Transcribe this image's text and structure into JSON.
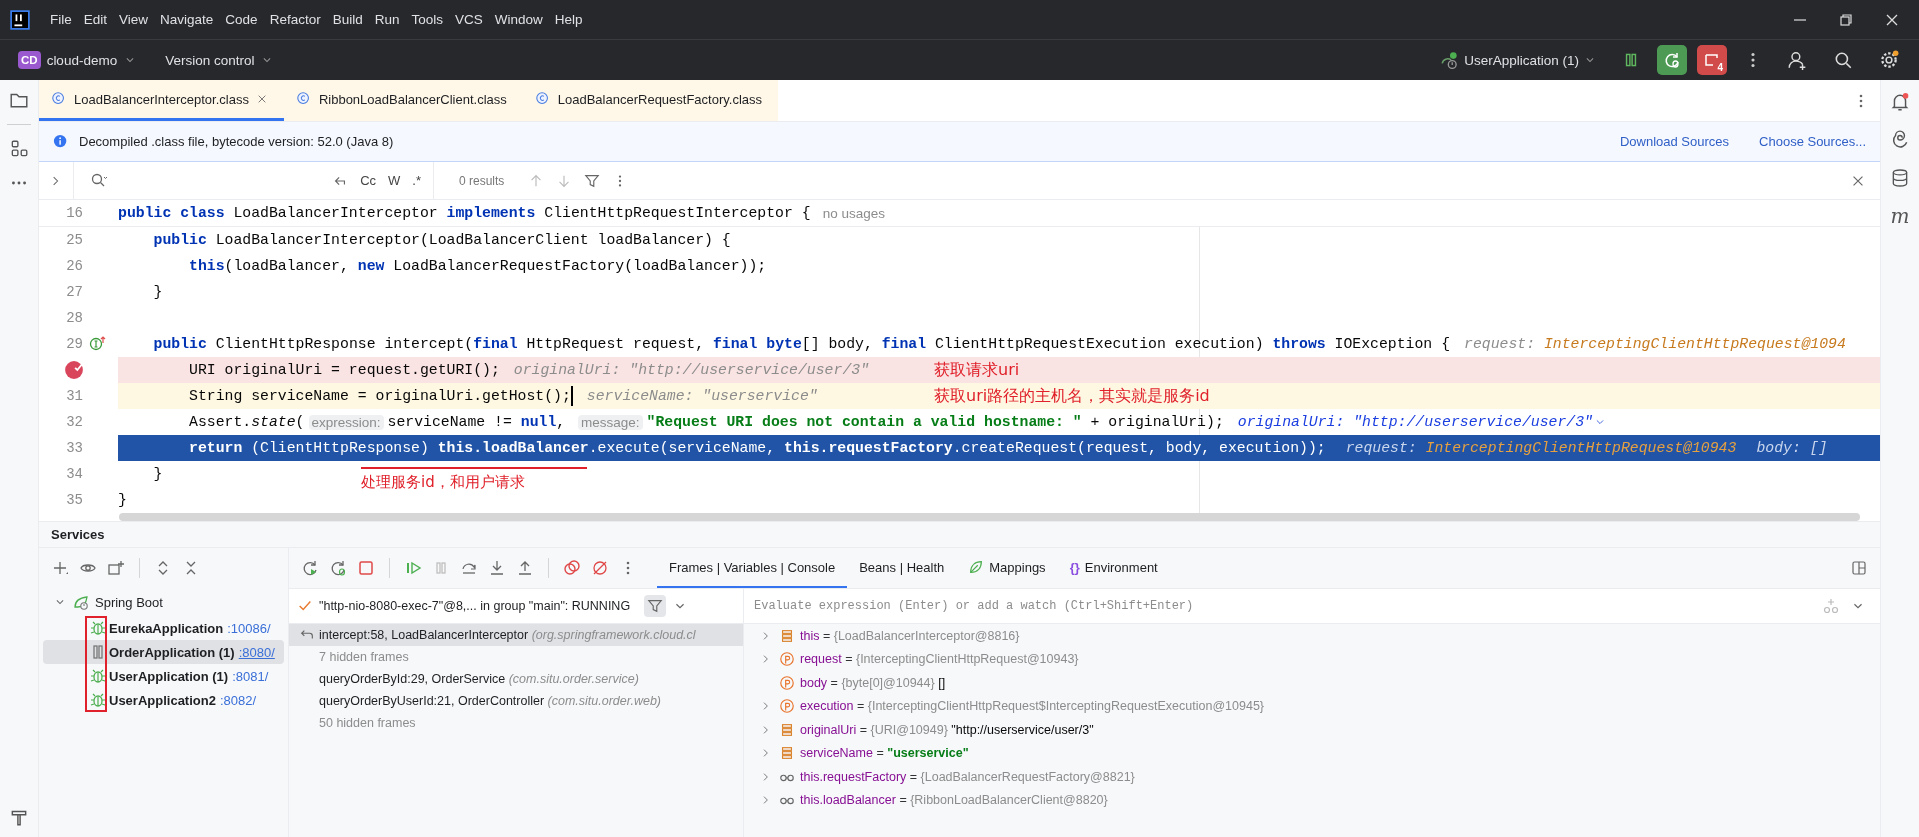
{
  "menu": {
    "items": [
      "File",
      "Edit",
      "View",
      "Navigate",
      "Code",
      "Refactor",
      "Build",
      "Run",
      "Tools",
      "VCS",
      "Window",
      "Help"
    ]
  },
  "toolbar": {
    "project_badge": "CD",
    "project": "cloud-demo",
    "vcs": "Version control",
    "run_config": "UserApplication (1)",
    "stop_count": "4"
  },
  "editor_tabs": [
    {
      "label": "LoadBalancerInterceptor.class",
      "selected": true
    },
    {
      "label": "RibbonLoadBalancerClient.class",
      "selected": false
    },
    {
      "label": "LoadBalancerRequestFactory.class",
      "selected": false
    }
  ],
  "info_bar": {
    "text": "Decompiled .class file, bytecode version: 52.0 (Java 8)",
    "links": [
      "Download Sources",
      "Choose Sources..."
    ]
  },
  "find_bar": {
    "options": [
      "Cc",
      "W",
      ".*"
    ],
    "results": "0 results"
  },
  "code": {
    "sticky": {
      "number": "16",
      "tokens": [
        {
          "text": "public class ",
          "kind": "kw"
        },
        {
          "text": "LoadBalancerInterceptor "
        },
        {
          "text": "implements ",
          "kind": "kw"
        },
        {
          "text": "ClientHttpRequestInterceptor {"
        },
        {
          "text": "no usages",
          "kind": "usage"
        }
      ]
    },
    "lines": [
      {
        "number": "25",
        "kind": "normal",
        "tokens": [
          {
            "text": "    public ",
            "kind": "kw"
          },
          {
            "text": "LoadBalancerInterceptor(LoadBalancerClient loadBalancer) {"
          }
        ]
      },
      {
        "number": "26",
        "kind": "normal",
        "tokens": [
          {
            "text": "        this",
            "kind": "kw"
          },
          {
            "text": "(loadBalancer, "
          },
          {
            "text": "new ",
            "kind": "kw"
          },
          {
            "text": "LoadBalancerRequestFactory(loadBalancer));"
          }
        ]
      },
      {
        "number": "27",
        "kind": "normal",
        "tokens": [
          {
            "text": "    }"
          }
        ]
      },
      {
        "number": "28",
        "kind": "normal"
      },
      {
        "number": "29",
        "kind": "normal",
        "implements_marker": true,
        "tokens": [
          {
            "text": "    public ",
            "kind": "kw"
          },
          {
            "text": "ClientHttpResponse intercept("
          },
          {
            "text": "final ",
            "kind": "kw"
          },
          {
            "text": "HttpRequest request, "
          },
          {
            "text": "final byte",
            "kind": "kw"
          },
          {
            "text": "[] body, "
          },
          {
            "text": "final ",
            "kind": "kw"
          },
          {
            "text": "ClientHttpRequestExecution execution) "
          },
          {
            "text": "throws ",
            "kind": "kw"
          },
          {
            "text": "IOException {"
          },
          {
            "text": "request: ",
            "kind": "dbg"
          },
          {
            "text": "InterceptingClientHttpRequest@1094",
            "kind": "dbgval"
          }
        ]
      },
      {
        "kind": "breakpoint",
        "note": "获取请求uri",
        "tokens": [
          {
            "text": "        URI originalUri = request.getURI();"
          },
          {
            "text": "originalUri: ",
            "kind": "dbg"
          },
          {
            "text": "\"http://userservice/user/3\"",
            "kind": "dbgtext"
          }
        ]
      },
      {
        "number": "31",
        "kind": "caret",
        "note": "获取uri路径的主机名，其实就是服务id",
        "tokens": [
          {
            "text": "        String serviceName = originalUri.getHost();",
            "caret_after": true
          },
          {
            "text": "serviceName: \"userservice\"",
            "kind": "dbg"
          }
        ]
      },
      {
        "number": "32",
        "kind": "normal",
        "chevron": true,
        "tokens": [
          {
            "text": "        Assert."
          },
          {
            "text": "state",
            "kind": "it"
          },
          {
            "text": "("
          },
          {
            "text": "expression:",
            "kind": "hint"
          },
          {
            "text": "serviceName != "
          },
          {
            "text": "null",
            "kind": "kw"
          },
          {
            "text": ", "
          },
          {
            "text": "message:",
            "kind": "hint"
          },
          {
            "text": "\"Request URI does not contain a valid hostname: \"",
            "kind": "str"
          },
          {
            "text": " + originalUri);"
          },
          {
            "text": "originalUri: ",
            "kind": "dbglink"
          },
          {
            "text": "\"http://userservice/user/3\"",
            "kind": "dbglinkval"
          }
        ]
      },
      {
        "number": "33",
        "kind": "execution",
        "tokens": [
          {
            "text": "        return ",
            "kind": "kw"
          },
          {
            "text": "(ClientHttpResponse) "
          },
          {
            "text": "this.loadBalancer",
            "kind": "bold"
          },
          {
            "text": ".execute(serviceName, "
          },
          {
            "text": "this.requestFactory",
            "kind": "bold"
          },
          {
            "text": ".createRequest(request, body, execution));"
          },
          {
            "text": "request: ",
            "kind": "dbg"
          },
          {
            "text": "InterceptingClientHttpRequest@10943",
            "kind": "dbgval"
          },
          {
            "text": "body: []",
            "kind": "dbg"
          }
        ]
      },
      {
        "number": "34",
        "kind": "normal",
        "tokens": [
          {
            "text": "    }"
          }
        ]
      },
      {
        "number": "35",
        "kind": "normal",
        "tokens": [
          {
            "text": "}"
          }
        ]
      }
    ],
    "annotation": "处理服务id，和用户请求"
  },
  "right_strip": {
    "label": "m"
  },
  "services": {
    "title": "Services",
    "tree": {
      "label": "Spring Boot",
      "expanded": true,
      "children": [
        {
          "name": "EurekaApplication",
          "port": ":10086/",
          "kind": "debug",
          "selected": false
        },
        {
          "name": "OrderApplication (1)",
          "port": ":8080/",
          "kind": "paused",
          "selected": true
        },
        {
          "name": "UserApplication (1)",
          "port": ":8081/",
          "kind": "debug",
          "selected": false
        },
        {
          "name": "UserApplication2",
          "port": ":8082/",
          "kind": "debug",
          "selected": false
        }
      ]
    }
  },
  "debugger": {
    "tabs": [
      {
        "label": "Frames | Variables | Console",
        "kind": "plain",
        "selected": true
      },
      {
        "label": "Beans | Health",
        "kind": "plain",
        "selected": false
      },
      {
        "label": "Mappings",
        "kind": "leaf",
        "selected": false
      },
      {
        "label": "Environment",
        "kind": "glyph",
        "glyph": "{}",
        "selected": false
      }
    ],
    "thread": "\"http-nio-8080-exec-7\"@8,... in group \"main\": RUNNING",
    "frames": [
      {
        "kind": "frame",
        "method": "intercept:58, LoadBalancerInterceptor",
        "package": "(org.springframework.cloud.cl",
        "selected": true
      },
      {
        "kind": "hidden",
        "text": "7 hidden frames",
        "selected": false
      },
      {
        "kind": "frame",
        "method": "queryOrderById:29, OrderService",
        "package": "(com.situ.order.service)",
        "selected": false
      },
      {
        "kind": "frame",
        "method": "queryOrderByUserId:21, OrderController",
        "package": "(com.situ.order.web)",
        "selected": false
      },
      {
        "kind": "hidden",
        "text": "50 hidden frames",
        "selected": false
      }
    ],
    "evaluate": {
      "placeholder": "Evaluate expression (Enter) or add a watch (Ctrl+Shift+Enter)"
    },
    "variables": [
      {
        "kind": "field",
        "expandable": true,
        "name": "this",
        "sign": "=",
        "type": "{LoadBalancerInterceptor@8816}"
      },
      {
        "kind": "param",
        "expandable": true,
        "name": "request",
        "sign": "=",
        "type": "{InterceptingClientHttpRequest@10943}"
      },
      {
        "kind": "param",
        "expandable": false,
        "name": "body",
        "sign": "=",
        "type": "{byte[0]@10944}",
        "value": "[]",
        "is_string": false
      },
      {
        "kind": "param",
        "expandable": true,
        "name": "execution",
        "sign": "=",
        "type": "{InterceptingClientHttpRequest$InterceptingRequestExecution@10945}"
      },
      {
        "kind": "field",
        "expandable": true,
        "name": "originalUri",
        "sign": "=",
        "type": "{URI@10949}",
        "value": "\"http://userservice/user/3\"",
        "is_string": false
      },
      {
        "kind": "field",
        "expandable": true,
        "name": "serviceName",
        "sign": "=",
        "value": "\"userservice\"",
        "is_string": true
      },
      {
        "kind": "watch",
        "expandable": true,
        "name": "this.requestFactory",
        "sign": "=",
        "type": "{LoadBalancerRequestFactory@8821}"
      },
      {
        "kind": "watch",
        "expandable": true,
        "name": "this.loadBalancer",
        "sign": "=",
        "type": "{RibbonLoadBalancerClient@8820}"
      }
    ]
  }
}
